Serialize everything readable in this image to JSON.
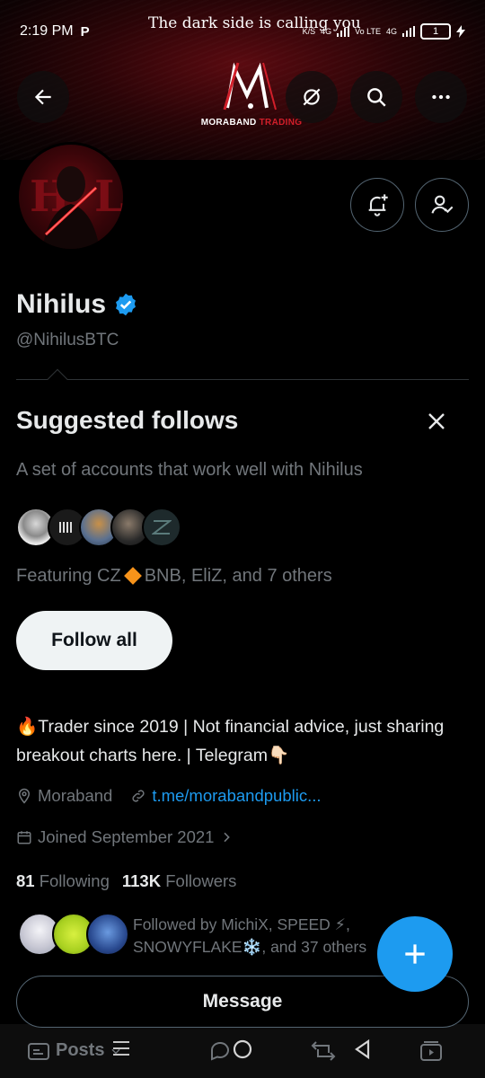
{
  "status_bar": {
    "time": "2:19 PM",
    "p_icon": "P",
    "net_rate": "K/S",
    "net_4g_1": "4G",
    "volte": "Vo LTE",
    "net_4g_2": "4G",
    "battery": "1"
  },
  "banner": {
    "caption": "The dark side is calling you",
    "logo_main": "MORABAND",
    "logo_accent": "TRADING"
  },
  "header_icons": {
    "back": "back-arrow-icon",
    "grok": "grok-icon",
    "search": "search-icon",
    "more": "more-icon"
  },
  "profile": {
    "name": "Nihilus",
    "handle": "@NihilusBTC",
    "verified": true
  },
  "suggested": {
    "title": "Suggested follows",
    "subtitle": "A set of accounts that work well with Nihilus",
    "featuring_prefix": "Featuring CZ",
    "featuring_suffix": "BNB, EliZ, and 7 others",
    "follow_all": "Follow all"
  },
  "bio": {
    "text": "🔥Trader since 2019 | Not financial advice, just sharing breakout charts here. | Telegram👇🏻"
  },
  "meta": {
    "location": "Moraband",
    "link": "t.me/morabandpublic...",
    "joined": "Joined September 2021"
  },
  "counts": {
    "following_num": "81",
    "following_label": "Following",
    "followers_num": "113K",
    "followers_label": "Followers"
  },
  "followed_by": {
    "line1": "Followed by MichiX, SPEED ⚡,",
    "line2": "SNOWYFLAKE❄️, and 37 others"
  },
  "message_button": "Message",
  "bottom_tabs": {
    "posts": "Posts"
  },
  "colors": {
    "accent": "#1d9bf0",
    "muted": "#71767b",
    "brand_red": "#d21f2a"
  }
}
